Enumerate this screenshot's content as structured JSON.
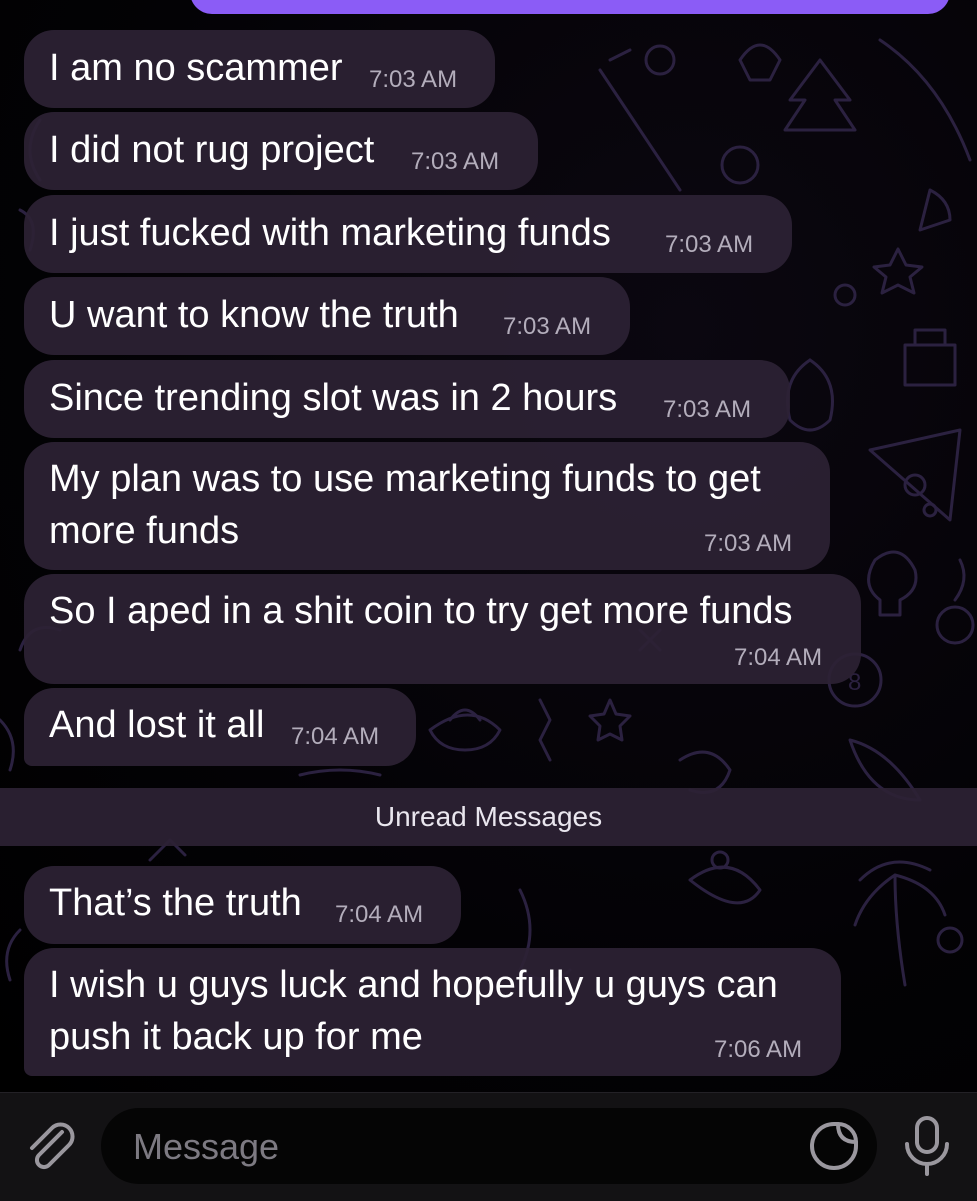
{
  "messages": [
    {
      "text": "I am no scammer",
      "time": "7:03 AM"
    },
    {
      "text": "I did not rug project",
      "time": "7:03 AM"
    },
    {
      "text": "I just fucked with marketing funds",
      "time": "7:03 AM"
    },
    {
      "text": "U want to know the truth",
      "time": "7:03 AM"
    },
    {
      "text": "Since trending slot was in 2 hours",
      "time": "7:03 AM"
    },
    {
      "line1": "My plan was to use marketing funds to get",
      "line2": "more funds",
      "time": "7:03 AM"
    },
    {
      "text": "So I aped in a shit coin to try get more funds",
      "time": "7:04 AM"
    },
    {
      "text": "And lost it all",
      "time": "7:04 AM"
    },
    {
      "text": "That’s the truth",
      "time": "7:04 AM"
    },
    {
      "line1": "I wish u guys luck and hopefully u guys can",
      "line2": "push it back up for me",
      "time": "7:06 AM"
    }
  ],
  "divider": {
    "label": "Unread Messages"
  },
  "composer": {
    "placeholder": "Message"
  },
  "icons": {
    "attach": "paperclip-icon",
    "sticker": "sticker-icon",
    "mic": "microphone-icon"
  },
  "colors": {
    "bubble": "#2c2234",
    "outgoing_bubble": "#8b5cf6",
    "timestamp": "#b3adbb",
    "doodle": "#2b2140",
    "input_bar": "#131214"
  }
}
